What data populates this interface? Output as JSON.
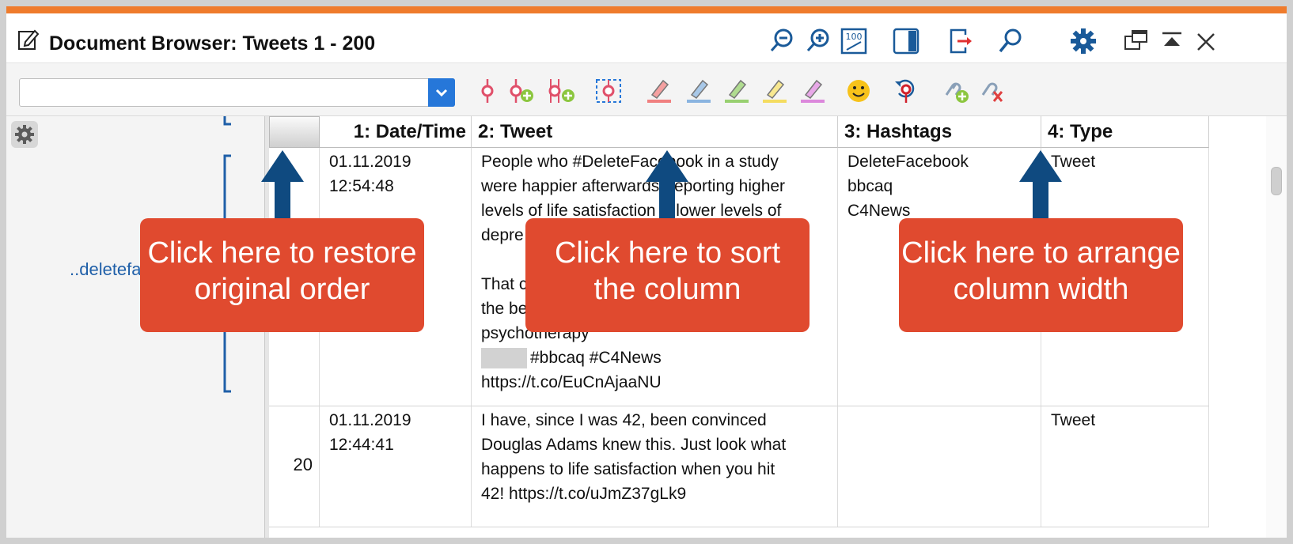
{
  "window": {
    "title": "Document Browser: Tweets 1 - 200",
    "accent_color": "#ef7b2c",
    "icons": [
      "zoom-out-icon",
      "zoom-in-icon",
      "zoom-100-icon",
      "sidebar-panel-icon",
      "export-icon",
      "search-icon",
      "settings-gear-icon",
      "detach-window-icon",
      "collapse-icon",
      "close-icon"
    ]
  },
  "toolbar": {
    "document_select_value": "",
    "icons": [
      "code-icon",
      "code-add-icon",
      "code-multiple-add-icon",
      "code-selection-icon",
      "highlight-red-icon",
      "highlight-blue-icon",
      "highlight-green-icon",
      "highlight-yellow-icon",
      "highlight-purple-icon",
      "emoticode-icon",
      "undo-code-icon",
      "link-add-icon",
      "link-delete-icon"
    ]
  },
  "sidebar": {
    "label": "..deletefa"
  },
  "table": {
    "columns": [
      "1: Date/Time",
      "2: Tweet",
      "3: Hashtags",
      "4: Type"
    ],
    "rows": [
      {
        "number": "",
        "date": "01.11.2019",
        "time": "12:54:48",
        "tweet_lines": [
          "People who #DeleteFacebook in a study",
          "were happier afterwards, reporting higher",
          "levels of life satisfaction & lower levels of",
          "depre",
          "",
          "That c",
          "the be",
          "psychotherapy",
          "#bbcaq #C4News",
          " https://t.co/EuCnAjaaNU"
        ],
        "hashtags": [
          "DeleteFacebook",
          "bbcaq",
          "C4News"
        ],
        "type": "Tweet"
      },
      {
        "number": "20",
        "date": "01.11.2019",
        "time": "12:44:41",
        "tweet_lines": [
          "I have, since I was 42, been convinced",
          "Douglas Adams knew this. Just look what",
          "happens to life satisfaction when you hit",
          "42! https://t.co/uJmZ37gLk9"
        ],
        "hashtags": [],
        "type": "Tweet"
      }
    ]
  },
  "callouts": {
    "restore": [
      "Click here to restore",
      "original order"
    ],
    "sort": [
      "Click here to sort",
      "the column"
    ],
    "arrange": [
      "Click here to arrange",
      "column width"
    ],
    "color": "#e04a2f",
    "arrow_color": "#0f4a80"
  }
}
